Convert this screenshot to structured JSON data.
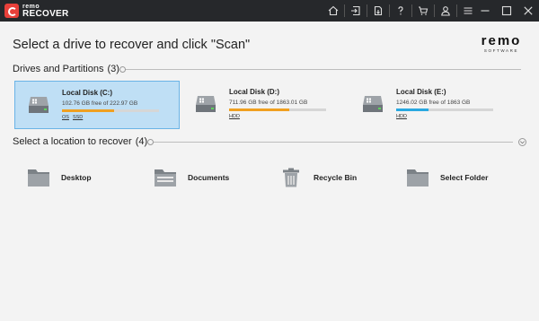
{
  "app": {
    "brand": "remo",
    "product": "RECOVER"
  },
  "header": {
    "title": "Select a drive to recover and click \"Scan\"",
    "brand_logo_main": "remo",
    "brand_logo_sub": "SOFTWARE"
  },
  "drives_section": {
    "title": "Drives and Partitions",
    "count": "(3)",
    "drives": [
      {
        "name": "Local Disk (C:)",
        "free": "102.76 GB free of 222.97 GB",
        "tags": [
          "OS",
          "SSD"
        ],
        "used_fraction": 0.54,
        "bar_color": "#f0a020",
        "selected": true
      },
      {
        "name": "Local Disk (D:)",
        "free": "711.96 GB free of 1863.01 GB",
        "tags": [
          "HDD"
        ],
        "used_fraction": 0.62,
        "bar_color": "#f0a020",
        "selected": false
      },
      {
        "name": "Local Disk (E:)",
        "free": "1246.02 GB free of 1863 GB",
        "tags": [
          "HDD"
        ],
        "used_fraction": 0.33,
        "bar_color": "#29a8e0",
        "selected": false
      }
    ]
  },
  "locations_section": {
    "title": "Select a location to recover",
    "count": "(4)",
    "items": [
      {
        "label": "Desktop",
        "icon": "folder-icon"
      },
      {
        "label": "Documents",
        "icon": "documents-icon"
      },
      {
        "label": "Recycle Bin",
        "icon": "recycle-bin-icon"
      },
      {
        "label": "Select Folder",
        "icon": "folder-icon"
      }
    ]
  },
  "colors": {
    "titlebar": "#26282b",
    "selected_bg": "#bfdff5",
    "selected_border": "#6ab3e6",
    "logo_red": "#e8403a"
  }
}
